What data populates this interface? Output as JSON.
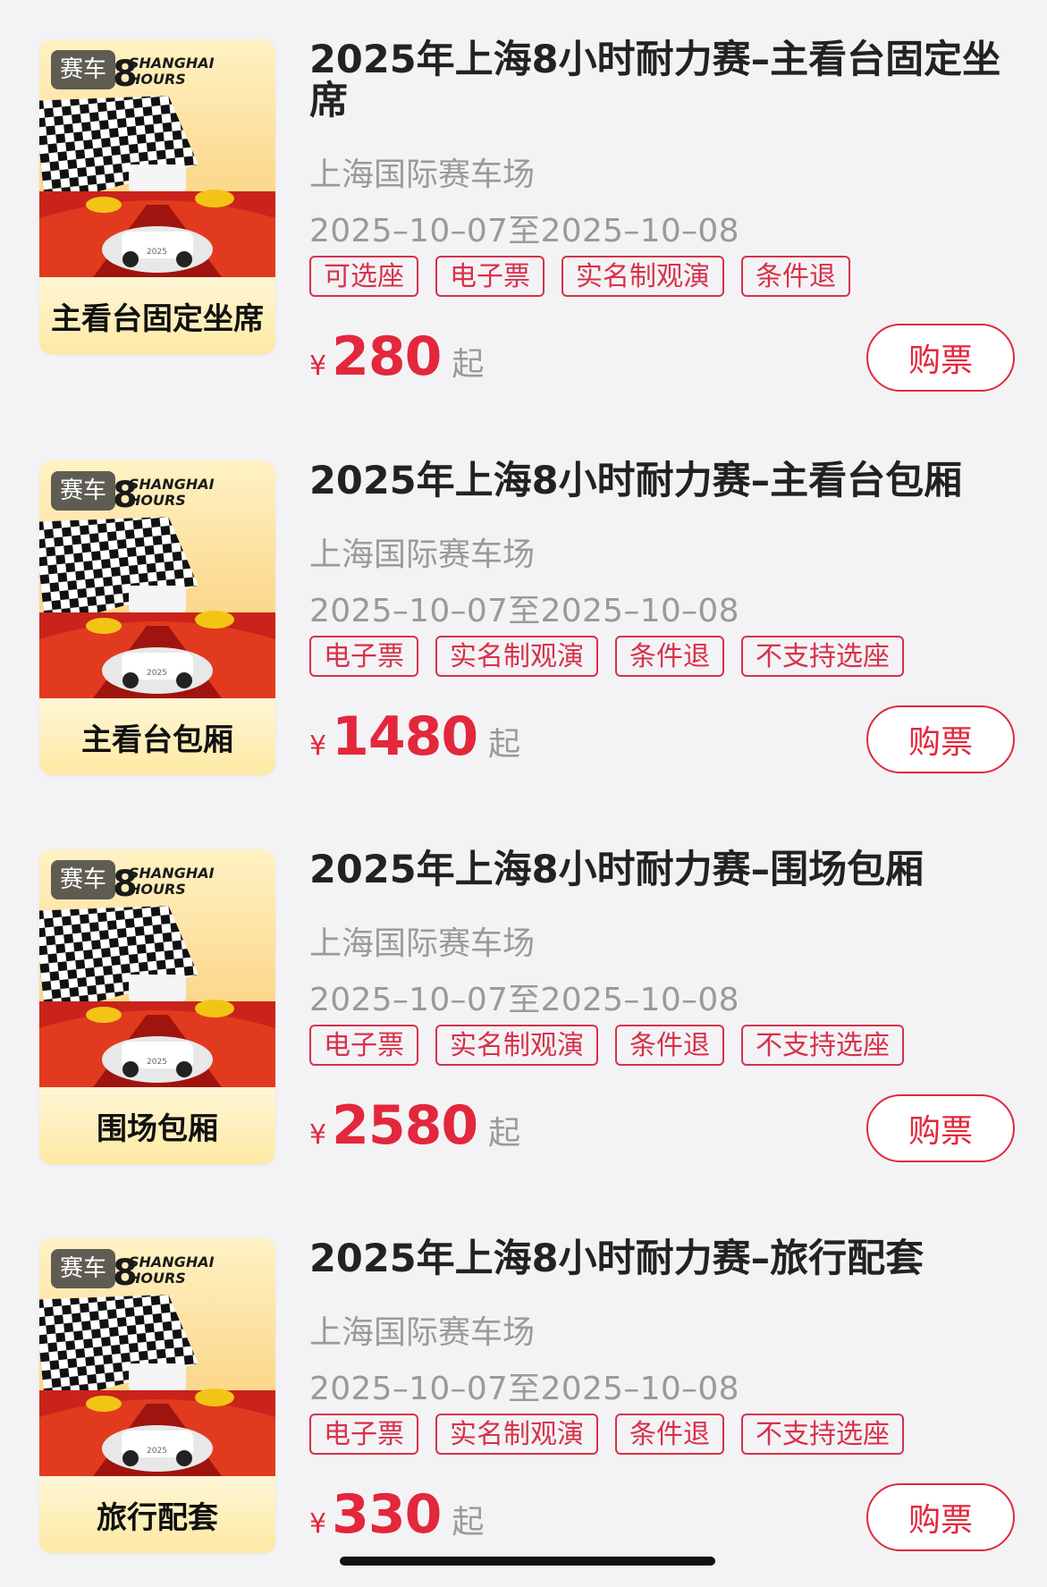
{
  "items": [
    {
      "category": "赛车",
      "poster_caption": "主看台固定坐席",
      "title": "2025年上海8小时耐力赛–主看台固定坐席",
      "venue": "上海国际赛车场",
      "date": "2025–10–07至2025–10–08",
      "tags": [
        "可选座",
        "电子票",
        "实名制观演",
        "条件退"
      ],
      "currency": "¥",
      "price": "280",
      "price_suffix": "起",
      "buy_label": "购票"
    },
    {
      "category": "赛车",
      "poster_caption": "主看台包厢",
      "title": "2025年上海8小时耐力赛–主看台包厢",
      "venue": "上海国际赛车场",
      "date": "2025–10–07至2025–10–08",
      "tags": [
        "电子票",
        "实名制观演",
        "条件退",
        "不支持选座"
      ],
      "currency": "¥",
      "price": "1480",
      "price_suffix": "起",
      "buy_label": "购票"
    },
    {
      "category": "赛车",
      "poster_caption": "围场包厢",
      "title": "2025年上海8小时耐力赛–围场包厢",
      "venue": "上海国际赛车场",
      "date": "2025–10–07至2025–10–08",
      "tags": [
        "电子票",
        "实名制观演",
        "条件退",
        "不支持选座"
      ],
      "currency": "¥",
      "price": "2580",
      "price_suffix": "起",
      "buy_label": "购票"
    },
    {
      "category": "赛车",
      "poster_caption": "旅行配套",
      "title": "2025年上海8小时耐力赛–旅行配套",
      "venue": "上海国际赛车场",
      "date": "2025–10–07至2025–10–08",
      "tags": [
        "电子票",
        "实名制观演",
        "条件退",
        "不支持选座"
      ],
      "currency": "¥",
      "price": "330",
      "price_suffix": "起",
      "buy_label": "购票"
    }
  ],
  "poster_logo": {
    "line1": "SHANGHAI",
    "line2": "HOURS",
    "big": "8",
    "year": "2025"
  },
  "colors": {
    "accent": "#e3273c",
    "tag_border": "#d8314a",
    "muted_text": "#9a9a9a",
    "title_text": "#222222",
    "background": "#f3f3f5"
  }
}
